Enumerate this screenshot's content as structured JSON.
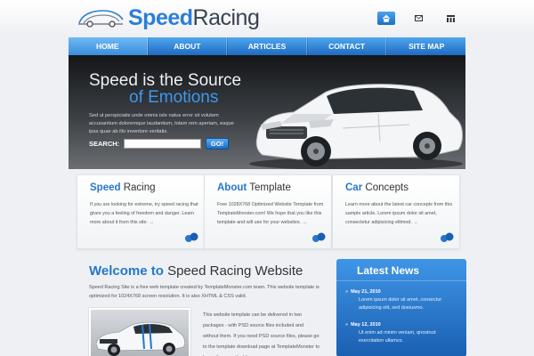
{
  "header": {
    "logo": {
      "word1": "Speed",
      "word2": "Racing"
    },
    "icons": [
      "home-icon",
      "mail-icon",
      "sitemap-icon"
    ]
  },
  "nav": {
    "items": [
      "HOME",
      "ABOUT",
      "ARTICLES",
      "CONTACT",
      "SITE MAP"
    ],
    "active": "HOME"
  },
  "hero": {
    "headline_line1": "Speed is the Source",
    "headline_line2": "of Emotions",
    "body": "Sed ut perspiciatis unde omnis iste natus error sit volutem accusantium doloremque laudantium, totam rem aperiam, eaque ipsa quae ab illo inventore veritatis.",
    "search_label": "SEARCH:",
    "search_value": "",
    "go_label": "GO!"
  },
  "columns": [
    {
      "title_highlight": "Speed",
      "title_rest": "Racing",
      "body": "If you are looking for extreme, try speed racing that gives you a feeling of freedom and danger. Learn more about it from this site."
    },
    {
      "title_highlight": "About",
      "title_rest": "Template",
      "body": "Free 1028X768 Optimized Website Template from TemplateMonster.com! We hope that you like this template and will use for your websites."
    },
    {
      "title_highlight": "Car",
      "title_rest": "Concepts",
      "body": "Learn more about the latest car concepts from this sample article. Lorem ipsum dolor sit amet, consectetur adipisicing elitmod."
    }
  ],
  "welcome": {
    "title_highlight": "Welcome to",
    "title_rest": "Speed Racing Website",
    "body": "Speed Racing Site is a free web template created by TemplateMonster.com team. This website template is optimized for 1024X768 screen resolution. It is also XHTML & CSS valid.",
    "body2": "This website template can be delivered in two packages - with PSD source files included and without them. If you need PSD source files, please go to the template download page at TemplateMonster to leave the e-mail address"
  },
  "news": {
    "title": "Latest News",
    "items": [
      {
        "date": "May 21, 2010",
        "text": "Lorem ipsum dolor sit amet, consectur adipisicing elit, sed doeiusmo."
      },
      {
        "date": "May 12, 2010",
        "text": "Ut enim ad minim veniam, qnostrud exercitation ullamco."
      }
    ]
  },
  "colors": {
    "brand_blue": "#2577cf",
    "nav_top": "#4ea6ee",
    "nav_bottom": "#1f6bc0",
    "hero_dark": "#141618",
    "news_blue": "#1a5fb2"
  }
}
